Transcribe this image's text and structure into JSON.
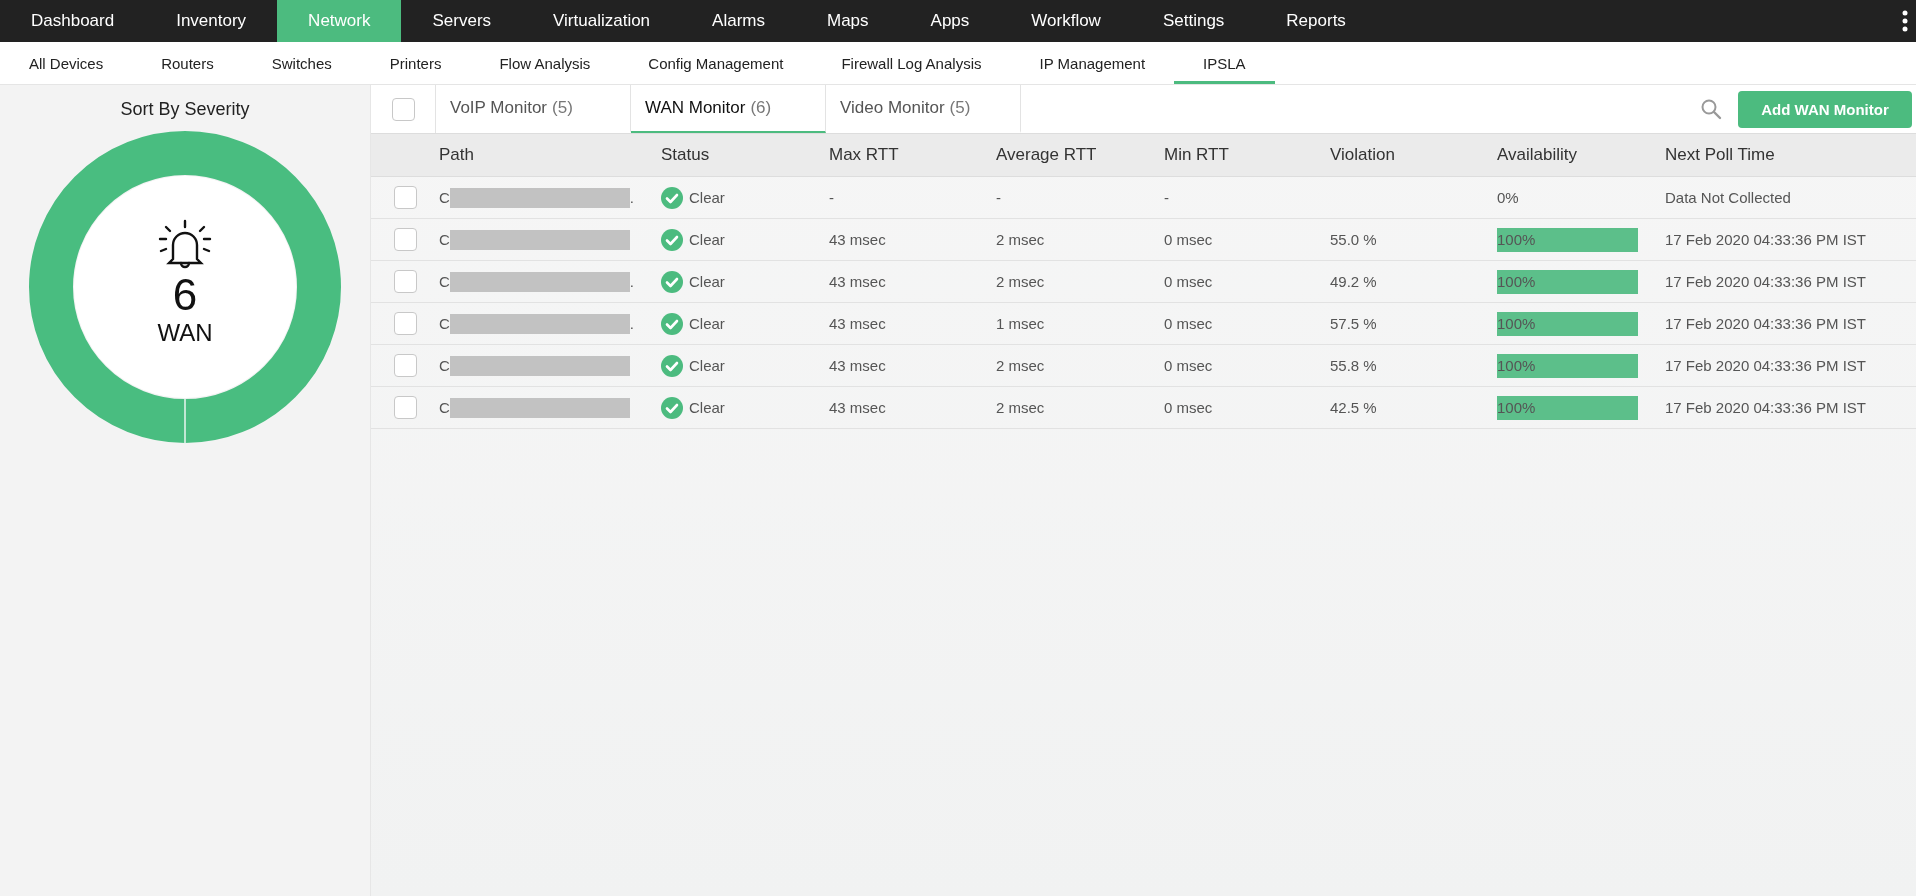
{
  "nav": [
    {
      "label": "Dashboard",
      "selected": false
    },
    {
      "label": "Inventory",
      "selected": false
    },
    {
      "label": "Network",
      "selected": true
    },
    {
      "label": "Servers",
      "selected": false
    },
    {
      "label": "Virtualization",
      "selected": false
    },
    {
      "label": "Alarms",
      "selected": false
    },
    {
      "label": "Maps",
      "selected": false
    },
    {
      "label": "Apps",
      "selected": false
    },
    {
      "label": "Workflow",
      "selected": false
    },
    {
      "label": "Settings",
      "selected": false
    },
    {
      "label": "Reports",
      "selected": false
    }
  ],
  "subnav": [
    {
      "label": "All Devices",
      "selected": false
    },
    {
      "label": "Routers",
      "selected": false
    },
    {
      "label": "Switches",
      "selected": false
    },
    {
      "label": "Printers",
      "selected": false
    },
    {
      "label": "Flow Analysis",
      "selected": false
    },
    {
      "label": "Config Management",
      "selected": false
    },
    {
      "label": "Firewall Log Analysis",
      "selected": false
    },
    {
      "label": "IP Management",
      "selected": false
    },
    {
      "label": "IPSLA",
      "selected": true
    }
  ],
  "severity_panel": {
    "title": "Sort By Severity",
    "count": "6",
    "label": "WAN"
  },
  "select_all": {
    "checked": false
  },
  "tabs": [
    {
      "label": "VoIP Monitor",
      "count": "(5)",
      "selected": false
    },
    {
      "label": "WAN Monitor",
      "count": "(6)",
      "selected": true
    },
    {
      "label": "Video Monitor",
      "count": "(5)",
      "selected": false
    }
  ],
  "add_button": "Add WAN Monitor",
  "table": {
    "columns": [
      "Path",
      "Status",
      "Max RTT",
      "Average RTT",
      "Min RTT",
      "Violation",
      "Availability",
      "Next Poll Time"
    ],
    "rows": [
      {
        "checked": false,
        "path_start": "C",
        "path_end": ".",
        "status": "Clear",
        "max_rtt": "-",
        "avg_rtt": "-",
        "min_rtt": "-",
        "availability": {
          "text": "0%"
        },
        "next_poll": "Data Not Collected"
      },
      {
        "checked": false,
        "path_start": "C",
        "status": "Clear",
        "max_rtt": "43 msec",
        "avg_rtt": "2 msec",
        "min_rtt": "0 msec",
        "violation": "55.0 %",
        "availability": {
          "text": "100%",
          "level": 1
        },
        "next_poll": "17 Feb 2020 04:33:36 PM IST"
      },
      {
        "checked": false,
        "path_start": "C",
        "path_end": ".",
        "status": "Clear",
        "max_rtt": "43 msec",
        "avg_rtt": "2 msec",
        "min_rtt": "0 msec",
        "violation": "49.2 %",
        "availability": {
          "text": "100%",
          "level": 1
        },
        "next_poll": "17 Feb 2020 04:33:36 PM IST"
      },
      {
        "checked": false,
        "path_start": "C",
        "path_end": ".",
        "status": "Clear",
        "max_rtt": "43 msec",
        "avg_rtt": "1 msec",
        "min_rtt": "0 msec",
        "violation": "57.5 %",
        "availability": {
          "text": "100%",
          "level": 1
        },
        "next_poll": "17 Feb 2020 04:33:36 PM IST"
      },
      {
        "checked": false,
        "path_start": "C",
        "status": "Clear",
        "max_rtt": "43 msec",
        "avg_rtt": "2 msec",
        "min_rtt": "0 msec",
        "violation": "55.8 %",
        "availability": {
          "text": "100%",
          "level": 1
        },
        "next_poll": "17 Feb 2020 04:33:36 PM IST"
      },
      {
        "checked": false,
        "path_start": "C",
        "status": "Clear",
        "max_rtt": "43 msec",
        "avg_rtt": "2 msec",
        "min_rtt": "0 msec",
        "violation": "42.5 %",
        "availability": {
          "text": "100%",
          "level": 1
        },
        "next_poll": "17 Feb 2020 04:33:36 PM IST"
      }
    ]
  }
}
